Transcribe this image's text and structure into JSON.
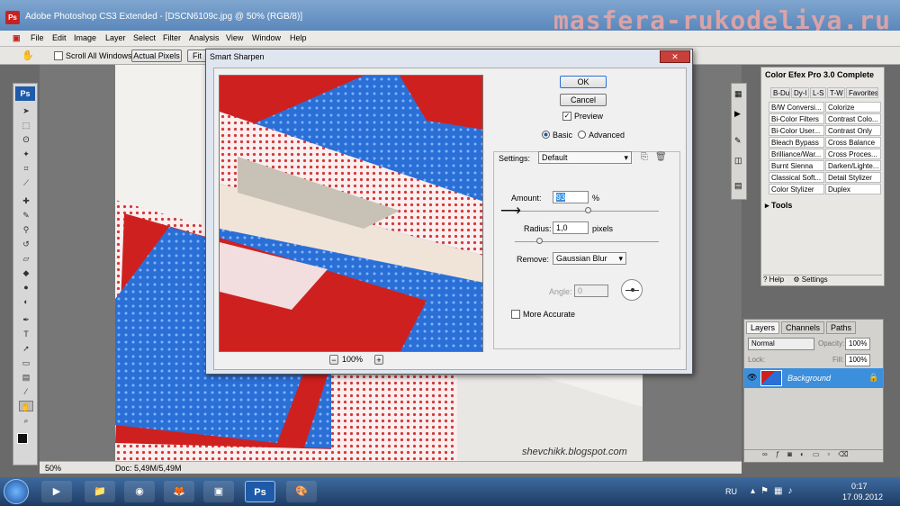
{
  "window": {
    "title": "Adobe Photoshop CS3 Extended - [DSCN6109c.jpg @ 50% (RGB/8)]",
    "app_icon": "Ps"
  },
  "watermark": "masfera-rukodeliya.ru",
  "menu": [
    "File",
    "Edit",
    "Image",
    "Layer",
    "Select",
    "Filter",
    "Analysis",
    "View",
    "Window",
    "Help"
  ],
  "options": {
    "scroll_all": "Scroll All Windows",
    "actual_pixels": "Actual Pixels",
    "fit": "Fit"
  },
  "toolbar_logo": "Ps",
  "photo": {
    "credit": "shevchikk.blogspot.com"
  },
  "status": {
    "zoom": "50%",
    "doc": "Doc: 5,49M/5,49M"
  },
  "dialog": {
    "title": "Smart Sharpen",
    "close": "✕",
    "ok": "OK",
    "cancel": "Cancel",
    "preview": "Preview",
    "mode_basic": "Basic",
    "mode_advanced": "Advanced",
    "settings_label": "Settings:",
    "settings_value": "Default",
    "amount_label": "Amount:",
    "amount_value": "93",
    "amount_unit": "%",
    "radius_label": "Radius:",
    "radius_value": "1,0",
    "radius_unit": "pixels",
    "remove_label": "Remove:",
    "remove_value": "Gaussian Blur",
    "angle_label": "Angle:",
    "angle_value": "0",
    "more_accurate": "More Accurate",
    "zoom_minus": "−",
    "zoom_value": "100%",
    "zoom_plus": "+"
  },
  "color_efex": {
    "title": "Color Efex Pro 3.0 Complete",
    "tabs": [
      "B-Du",
      "Dy-l",
      "L-S",
      "T-W",
      "Favorites"
    ],
    "filters": [
      [
        "B/W Conversi...",
        "Colorize"
      ],
      [
        "Bi-Color Filters",
        "Contrast Colo..."
      ],
      [
        "Bi-Color User...",
        "Contrast Only"
      ],
      [
        "Bleach Bypass",
        "Cross Balance"
      ],
      [
        "Brilliance/War...",
        "Cross Proces..."
      ],
      [
        "Burnt Sienna",
        "Darken/Lighte..."
      ],
      [
        "Classical Soft...",
        "Detail Stylizer"
      ],
      [
        "Color Stylizer",
        "Duplex"
      ]
    ],
    "tools": "Tools",
    "help": "Help",
    "settings": "Settings"
  },
  "layers": {
    "tabs": [
      "Layers",
      "Channels",
      "Paths"
    ],
    "blend": "Normal",
    "opacity_label": "Opacity:",
    "opacity": "100%",
    "lock_label": "Lock:",
    "fill_label": "Fill:",
    "fill": "100%",
    "layer_name": "Background"
  },
  "taskbar": {
    "lang": "RU",
    "time": "0:17",
    "date": "17.09.2012"
  },
  "colors": {
    "accent": "#3b8fdc",
    "ps_red": "#c8221f",
    "fabric_blue": "#2a6fd6",
    "fabric_red": "#cf2020"
  }
}
